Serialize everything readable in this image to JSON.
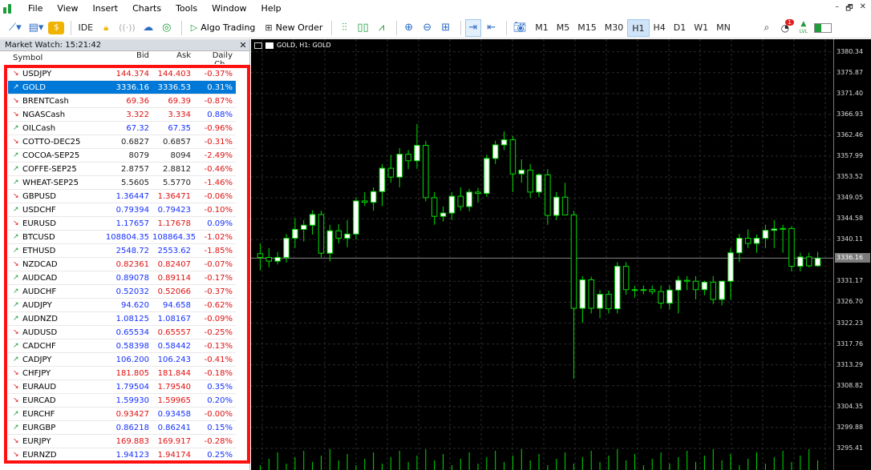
{
  "menu": [
    "File",
    "View",
    "Insert",
    "Charts",
    "Tools",
    "Window",
    "Help"
  ],
  "toolbar": {
    "ide": "IDE",
    "algo_trading": "Algo Trading",
    "new_order": "New Order",
    "timeframes": [
      "M1",
      "M5",
      "M15",
      "M30",
      "H1",
      "H4",
      "D1",
      "W1",
      "MN"
    ],
    "active_timeframe": "H1",
    "notification_count": "1",
    "lvl": "LVL"
  },
  "market_watch": {
    "title": "Market Watch: 15:21:42",
    "columns": [
      "Symbol",
      "Bid",
      "Ask",
      "Daily Ch..."
    ],
    "rows": [
      {
        "sym": "USDJPY",
        "bid": "144.374",
        "ask": "144.403",
        "chg": "-0.37%",
        "dir": "down",
        "bc": "red",
        "ac": "red",
        "cc": "red"
      },
      {
        "sym": "GOLD",
        "bid": "3336.16",
        "ask": "3336.53",
        "chg": "0.31%",
        "dir": "up",
        "bc": "white",
        "ac": "white",
        "cc": "white",
        "selected": true
      },
      {
        "sym": "BRENTCash",
        "bid": "69.36",
        "ask": "69.39",
        "chg": "-0.87%",
        "dir": "down",
        "bc": "red",
        "ac": "red",
        "cc": "red"
      },
      {
        "sym": "NGASCash",
        "bid": "3.322",
        "ask": "3.334",
        "chg": "0.88%",
        "dir": "down",
        "bc": "red",
        "ac": "red",
        "cc": "blue"
      },
      {
        "sym": "OILCash",
        "bid": "67.32",
        "ask": "67.35",
        "chg": "-0.96%",
        "dir": "up",
        "bc": "blue",
        "ac": "blue",
        "cc": "red"
      },
      {
        "sym": "COTTO-DEC25",
        "bid": "0.6827",
        "ask": "0.6857",
        "chg": "-0.31%",
        "dir": "down",
        "bc": "blk",
        "ac": "blk",
        "cc": "red"
      },
      {
        "sym": "COCOA-SEP25",
        "bid": "8079",
        "ask": "8094",
        "chg": "-2.49%",
        "dir": "up",
        "bc": "blk",
        "ac": "blk",
        "cc": "red"
      },
      {
        "sym": "COFFE-SEP25",
        "bid": "2.8757",
        "ask": "2.8812",
        "chg": "-0.46%",
        "dir": "up",
        "bc": "blk",
        "ac": "blk",
        "cc": "red"
      },
      {
        "sym": "WHEAT-SEP25",
        "bid": "5.5605",
        "ask": "5.5770",
        "chg": "-1.46%",
        "dir": "up",
        "bc": "blk",
        "ac": "blk",
        "cc": "red"
      },
      {
        "sym": "GBPUSD",
        "bid": "1.36447",
        "ask": "1.36471",
        "chg": "-0.06%",
        "dir": "down",
        "bc": "blue",
        "ac": "red",
        "cc": "red"
      },
      {
        "sym": "USDCHF",
        "bid": "0.79394",
        "ask": "0.79423",
        "chg": "-0.10%",
        "dir": "up",
        "bc": "blue",
        "ac": "blue",
        "cc": "red"
      },
      {
        "sym": "EURUSD",
        "bid": "1.17657",
        "ask": "1.17678",
        "chg": "0.09%",
        "dir": "down",
        "bc": "blue",
        "ac": "red",
        "cc": "blue"
      },
      {
        "sym": "BTCUSD",
        "bid": "108804.35",
        "ask": "108864.35",
        "chg": "-1.02%",
        "dir": "up",
        "bc": "blue",
        "ac": "blue",
        "cc": "red"
      },
      {
        "sym": "ETHUSD",
        "bid": "2548.72",
        "ask": "2553.62",
        "chg": "-1.85%",
        "dir": "up",
        "bc": "blue",
        "ac": "blue",
        "cc": "red"
      },
      {
        "sym": "NZDCAD",
        "bid": "0.82361",
        "ask": "0.82407",
        "chg": "-0.07%",
        "dir": "down",
        "bc": "red",
        "ac": "red",
        "cc": "red"
      },
      {
        "sym": "AUDCAD",
        "bid": "0.89078",
        "ask": "0.89114",
        "chg": "-0.17%",
        "dir": "up",
        "bc": "blue",
        "ac": "red",
        "cc": "red"
      },
      {
        "sym": "AUDCHF",
        "bid": "0.52032",
        "ask": "0.52066",
        "chg": "-0.37%",
        "dir": "up",
        "bc": "blue",
        "ac": "red",
        "cc": "red"
      },
      {
        "sym": "AUDJPY",
        "bid": "94.620",
        "ask": "94.658",
        "chg": "-0.62%",
        "dir": "up",
        "bc": "blue",
        "ac": "blue",
        "cc": "red"
      },
      {
        "sym": "AUDNZD",
        "bid": "1.08125",
        "ask": "1.08167",
        "chg": "-0.09%",
        "dir": "up",
        "bc": "blue",
        "ac": "blue",
        "cc": "red"
      },
      {
        "sym": "AUDUSD",
        "bid": "0.65534",
        "ask": "0.65557",
        "chg": "-0.25%",
        "dir": "down",
        "bc": "blue",
        "ac": "red",
        "cc": "red"
      },
      {
        "sym": "CADCHF",
        "bid": "0.58398",
        "ask": "0.58442",
        "chg": "-0.13%",
        "dir": "up",
        "bc": "blue",
        "ac": "blue",
        "cc": "red"
      },
      {
        "sym": "CADJPY",
        "bid": "106.200",
        "ask": "106.243",
        "chg": "-0.41%",
        "dir": "up",
        "bc": "blue",
        "ac": "blue",
        "cc": "red"
      },
      {
        "sym": "CHFJPY",
        "bid": "181.805",
        "ask": "181.844",
        "chg": "-0.18%",
        "dir": "down",
        "bc": "red",
        "ac": "red",
        "cc": "red"
      },
      {
        "sym": "EURAUD",
        "bid": "1.79504",
        "ask": "1.79540",
        "chg": "0.35%",
        "dir": "down",
        "bc": "blue",
        "ac": "red",
        "cc": "blue"
      },
      {
        "sym": "EURCAD",
        "bid": "1.59930",
        "ask": "1.59965",
        "chg": "0.20%",
        "dir": "down",
        "bc": "blue",
        "ac": "red",
        "cc": "blue"
      },
      {
        "sym": "EURCHF",
        "bid": "0.93427",
        "ask": "0.93458",
        "chg": "-0.00%",
        "dir": "up",
        "bc": "red",
        "ac": "blue",
        "cc": "red"
      },
      {
        "sym": "EURGBP",
        "bid": "0.86218",
        "ask": "0.86241",
        "chg": "0.15%",
        "dir": "up",
        "bc": "blue",
        "ac": "blue",
        "cc": "blue"
      },
      {
        "sym": "EURJPY",
        "bid": "169.883",
        "ask": "169.917",
        "chg": "-0.28%",
        "dir": "down",
        "bc": "red",
        "ac": "red",
        "cc": "red"
      },
      {
        "sym": "EURNZD",
        "bid": "1.94123",
        "ask": "1.94174",
        "chg": "0.25%",
        "dir": "down",
        "bc": "blue",
        "ac": "red",
        "cc": "blue"
      }
    ]
  },
  "chart": {
    "title": "GOLD, H1: GOLD",
    "current_price": "3336.16",
    "y_labels": [
      "3380.34",
      "3375.87",
      "3371.40",
      "3366.93",
      "3362.46",
      "3357.99",
      "3353.52",
      "3349.05",
      "3344.58",
      "3340.11",
      "3331.17",
      "3326.70",
      "3322.23",
      "3317.76",
      "3313.29",
      "3308.82",
      "3304.35",
      "3299.88",
      "3295.41"
    ],
    "colors": {
      "bull": "#ffffff",
      "bear": "#000000",
      "wick": "#00dd00",
      "volume": "#00dd00",
      "grid": "#333333"
    }
  },
  "chart_data": {
    "type": "candlestick",
    "title": "GOLD, H1: GOLD",
    "ylim": [
      3293.0,
      3382.0
    ],
    "current_price": 3336.16,
    "candles": [
      {
        "o": 3337.1,
        "h": 3339.3,
        "l": 3333.5,
        "c": 3336.3
      },
      {
        "o": 3336.3,
        "h": 3338.3,
        "l": 3334.2,
        "c": 3335.5
      },
      {
        "o": 3335.5,
        "h": 3337.5,
        "l": 3334.8,
        "c": 3336.3
      },
      {
        "o": 3336.3,
        "h": 3341.3,
        "l": 3335.2,
        "c": 3340.4
      },
      {
        "o": 3340.4,
        "h": 3344.7,
        "l": 3338.3,
        "c": 3342.3
      },
      {
        "o": 3342.3,
        "h": 3344.3,
        "l": 3339.7,
        "c": 3343.2
      },
      {
        "o": 3343.2,
        "h": 3346.4,
        "l": 3341.2,
        "c": 3345.5
      },
      {
        "o": 3345.5,
        "h": 3346.3,
        "l": 3336.3,
        "c": 3337.2
      },
      {
        "o": 3337.2,
        "h": 3343.3,
        "l": 3335.4,
        "c": 3342.0
      },
      {
        "o": 3342.0,
        "h": 3343.4,
        "l": 3339.3,
        "c": 3340.4
      },
      {
        "o": 3340.4,
        "h": 3344.3,
        "l": 3338.5,
        "c": 3341.3
      },
      {
        "o": 3341.3,
        "h": 3349.2,
        "l": 3340.1,
        "c": 3348.4
      },
      {
        "o": 3348.4,
        "h": 3350.3,
        "l": 3347.3,
        "c": 3348.1
      },
      {
        "o": 3348.1,
        "h": 3351.3,
        "l": 3346.3,
        "c": 3350.4
      },
      {
        "o": 3350.4,
        "h": 3356.3,
        "l": 3347.3,
        "c": 3355.4
      },
      {
        "o": 3355.4,
        "h": 3358.3,
        "l": 3352.3,
        "c": 3353.5
      },
      {
        "o": 3353.5,
        "h": 3359.7,
        "l": 3351.3,
        "c": 3358.4
      },
      {
        "o": 3358.4,
        "h": 3359.3,
        "l": 3355.2,
        "c": 3357.0
      },
      {
        "o": 3357.0,
        "h": 3364.9,
        "l": 3355.3,
        "c": 3360.3
      },
      {
        "o": 3360.3,
        "h": 3361.3,
        "l": 3348.3,
        "c": 3349.1
      },
      {
        "o": 3349.1,
        "h": 3350.3,
        "l": 3343.3,
        "c": 3345.1
      },
      {
        "o": 3345.1,
        "h": 3347.2,
        "l": 3344.0,
        "c": 3345.8
      },
      {
        "o": 3345.8,
        "h": 3350.3,
        "l": 3344.3,
        "c": 3349.4
      },
      {
        "o": 3349.4,
        "h": 3351.3,
        "l": 3346.3,
        "c": 3347.2
      },
      {
        "o": 3347.2,
        "h": 3351.0,
        "l": 3346.2,
        "c": 3350.3
      },
      {
        "o": 3350.3,
        "h": 3351.2,
        "l": 3348.0,
        "c": 3350.0
      },
      {
        "o": 3350.0,
        "h": 3358.3,
        "l": 3349.3,
        "c": 3357.5
      },
      {
        "o": 3357.5,
        "h": 3361.3,
        "l": 3356.3,
        "c": 3360.4
      },
      {
        "o": 3360.4,
        "h": 3363.3,
        "l": 3359.3,
        "c": 3361.5
      },
      {
        "o": 3361.5,
        "h": 3362.3,
        "l": 3350.3,
        "c": 3354.2
      },
      {
        "o": 3354.2,
        "h": 3357.3,
        "l": 3352.3,
        "c": 3355.0
      },
      {
        "o": 3355.0,
        "h": 3356.3,
        "l": 3349.0,
        "c": 3350.3
      },
      {
        "o": 3350.3,
        "h": 3354.3,
        "l": 3349.2,
        "c": 3354.0
      },
      {
        "o": 3354.0,
        "h": 3355.2,
        "l": 3343.3,
        "c": 3345.3
      },
      {
        "o": 3345.3,
        "h": 3350.3,
        "l": 3344.3,
        "c": 3349.2
      },
      {
        "o": 3349.2,
        "h": 3352.3,
        "l": 3345.3,
        "c": 3345.4
      },
      {
        "o": 3345.4,
        "h": 3346.3,
        "l": 3310.3,
        "c": 3325.4
      },
      {
        "o": 3325.4,
        "h": 3332.3,
        "l": 3322.3,
        "c": 3331.5
      },
      {
        "o": 3331.5,
        "h": 3332.2,
        "l": 3324.3,
        "c": 3325.4
      },
      {
        "o": 3325.4,
        "h": 3329.3,
        "l": 3323.3,
        "c": 3328.4
      },
      {
        "o": 3328.4,
        "h": 3329.2,
        "l": 3324.3,
        "c": 3325.3
      },
      {
        "o": 3325.3,
        "h": 3335.3,
        "l": 3324.3,
        "c": 3334.4
      },
      {
        "o": 3334.4,
        "h": 3335.3,
        "l": 3328.3,
        "c": 3329.4
      },
      {
        "o": 3329.4,
        "h": 3330.2,
        "l": 3327.7,
        "c": 3329.3
      },
      {
        "o": 3329.3,
        "h": 3330.3,
        "l": 3328.4,
        "c": 3329.4
      },
      {
        "o": 3329.4,
        "h": 3330.3,
        "l": 3328.3,
        "c": 3329.0
      },
      {
        "o": 3329.0,
        "h": 3330.3,
        "l": 3325.3,
        "c": 3326.5
      },
      {
        "o": 3326.5,
        "h": 3330.3,
        "l": 3325.2,
        "c": 3329.3
      },
      {
        "o": 3329.3,
        "h": 3332.3,
        "l": 3324.3,
        "c": 3331.4
      },
      {
        "o": 3331.4,
        "h": 3332.3,
        "l": 3329.3,
        "c": 3331.2
      },
      {
        "o": 3331.2,
        "h": 3332.3,
        "l": 3327.3,
        "c": 3329.4
      },
      {
        "o": 3329.4,
        "h": 3331.3,
        "l": 3328.2,
        "c": 3331.0
      },
      {
        "o": 3331.0,
        "h": 3332.3,
        "l": 3326.3,
        "c": 3327.3
      },
      {
        "o": 3327.3,
        "h": 3331.3,
        "l": 3326.0,
        "c": 3331.2
      },
      {
        "o": 3331.2,
        "h": 3338.3,
        "l": 3327.3,
        "c": 3337.3
      },
      {
        "o": 3337.3,
        "h": 3341.3,
        "l": 3335.3,
        "c": 3340.4
      },
      {
        "o": 3340.4,
        "h": 3342.3,
        "l": 3338.3,
        "c": 3339.3
      },
      {
        "o": 3339.3,
        "h": 3341.2,
        "l": 3337.3,
        "c": 3340.4
      },
      {
        "o": 3340.4,
        "h": 3343.3,
        "l": 3338.3,
        "c": 3342.1
      },
      {
        "o": 3342.1,
        "h": 3344.3,
        "l": 3338.3,
        "c": 3342.4
      },
      {
        "o": 3342.4,
        "h": 3343.3,
        "l": 3337.3,
        "c": 3342.5
      },
      {
        "o": 3342.5,
        "h": 3343.0,
        "l": 3333.3,
        "c": 3334.4
      },
      {
        "o": 3334.4,
        "h": 3337.3,
        "l": 3333.3,
        "c": 3336.4
      },
      {
        "o": 3336.4,
        "h": 3337.3,
        "l": 3334.2,
        "c": 3334.5
      },
      {
        "o": 3334.5,
        "h": 3337.5,
        "l": 3334.3,
        "c": 3336.16
      }
    ]
  }
}
